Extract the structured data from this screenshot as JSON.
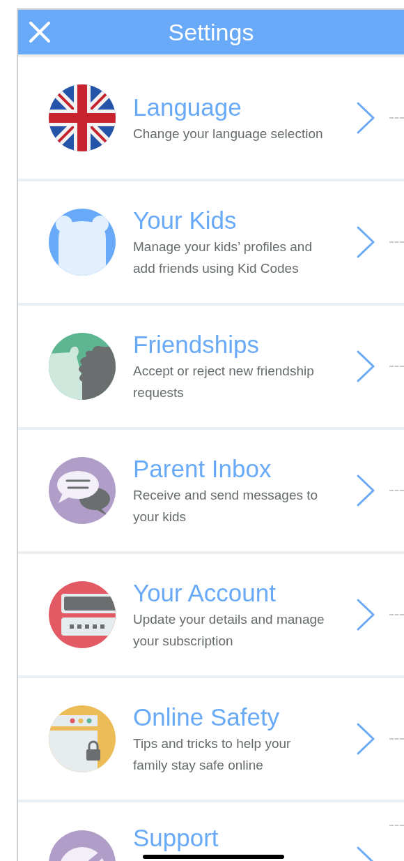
{
  "header": {
    "title": "Settings"
  },
  "items": [
    {
      "kind": "flag",
      "title": "Language",
      "subtitle": "Change your language selection"
    },
    {
      "kind": "bear",
      "title": "Your Kids",
      "subtitle": "Manage your kids’ profiles and add friends using Kid Codes"
    },
    {
      "kind": "friends",
      "title": "Friendships",
      "subtitle": "Accept or reject new friendship requests"
    },
    {
      "kind": "chat",
      "title": "Parent Inbox",
      "subtitle": "Receive and send messages to your kids"
    },
    {
      "kind": "card",
      "title": "Your Account",
      "subtitle": "Update your details and manage your subscription"
    },
    {
      "kind": "browser",
      "title": "Online Safety",
      "subtitle": "Tips and tricks to help your family stay safe online"
    },
    {
      "kind": "support",
      "title": "Support"
    }
  ]
}
